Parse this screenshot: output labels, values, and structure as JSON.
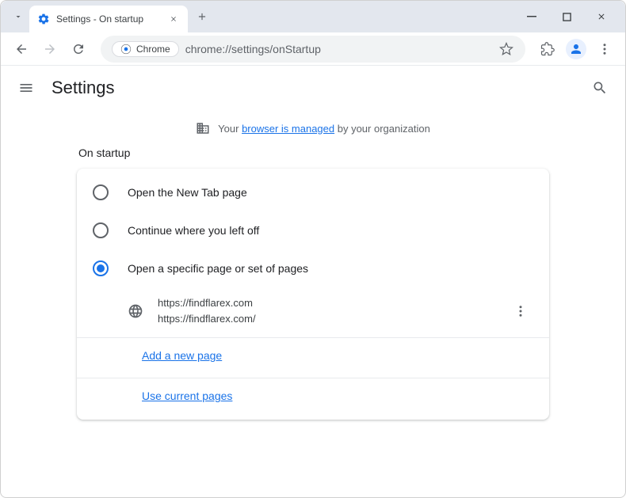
{
  "window": {
    "tab_title": "Settings - On startup",
    "omnibox_chip": "Chrome",
    "url": "chrome://settings/onStartup"
  },
  "header": {
    "title": "Settings"
  },
  "managed": {
    "prefix": "Your ",
    "link": "browser is managed",
    "suffix": " by your organization"
  },
  "section": {
    "title": "On startup",
    "options": [
      {
        "label": "Open the New Tab page",
        "selected": false
      },
      {
        "label": "Continue where you left off",
        "selected": false
      },
      {
        "label": "Open a specific page or set of pages",
        "selected": true
      }
    ],
    "page": {
      "title": "https://findflarex.com",
      "url": "https://findflarex.com/"
    },
    "add_page": "Add a new page",
    "use_current": "Use current pages"
  }
}
